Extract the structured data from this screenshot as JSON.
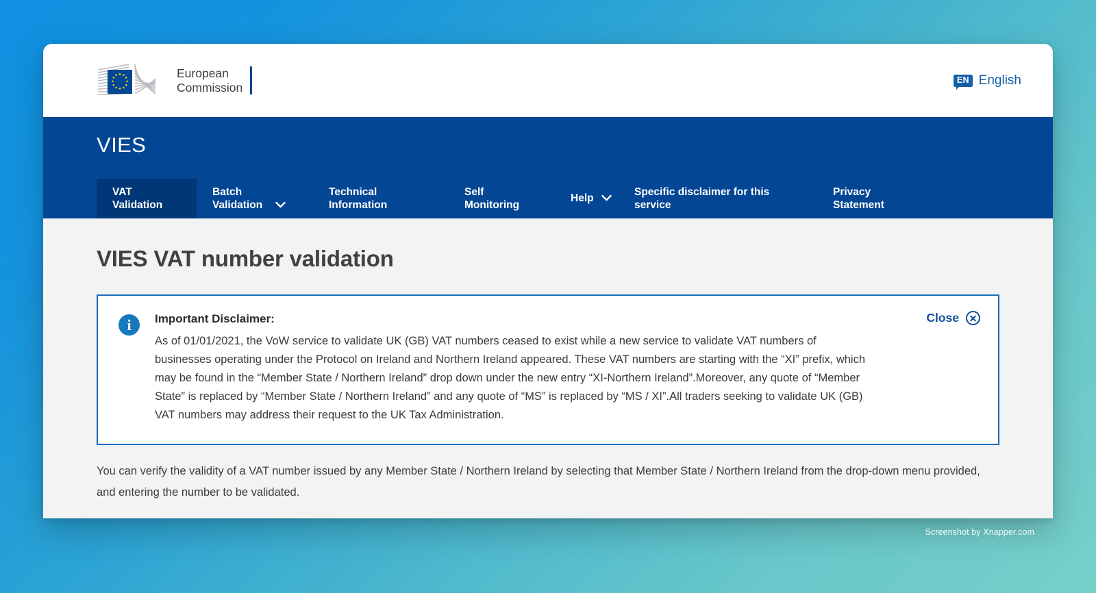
{
  "header": {
    "logo_line1": "European",
    "logo_line2": "Commission",
    "language": {
      "code": "EN",
      "label": "English"
    }
  },
  "nav": {
    "site_title": "VIES",
    "items": [
      {
        "label": "VAT\nValidation",
        "active": true,
        "has_chevron": false
      },
      {
        "label": "Batch\nValidation",
        "active": false,
        "has_chevron": true
      },
      {
        "label": "Technical\nInformation",
        "active": false,
        "has_chevron": false
      },
      {
        "label": "Self\nMonitoring",
        "active": false,
        "has_chevron": false
      },
      {
        "label": "Help",
        "active": false,
        "has_chevron": true
      },
      {
        "label": "Specific disclaimer for this\nservice",
        "active": false,
        "has_chevron": false
      },
      {
        "label": "Privacy\nStatement",
        "active": false,
        "has_chevron": false
      }
    ]
  },
  "main": {
    "page_title": "VIES VAT number validation",
    "disclaimer": {
      "icon": "info-icon",
      "title": "Important Disclaimer:",
      "text": "As of 01/01/2021, the VoW service to validate UK (GB) VAT numbers ceased to exist while a new service to validate VAT numbers of businesses operating under the Protocol on Ireland and Northern Ireland appeared. These VAT numbers are starting with the “XI” prefix, which may be found in the “Member State / Northern Ireland” drop down under the new entry “XI-Northern Ireland”.Moreover, any quote of “Member State” is replaced by “Member State / Northern Ireland” and any quote of “MS” is replaced by “MS / XI”.All traders seeking to validate UK (GB) VAT numbers may address their request to the UK Tax Administration.",
      "close_label": "Close"
    },
    "intro_text": "You can verify the validity of a VAT number issued by any Member State / Northern Ireland by selecting that Member State / Northern Ireland from the drop-down menu provided, and entering the number to be validated."
  },
  "watermark": "Screenshot by Xnapper.com",
  "colors": {
    "nav_blue": "#034694",
    "active_tab_blue": "#003776",
    "link_blue": "#14509c",
    "info_blue": "#1678bd",
    "page_bg": "#f3f3f3",
    "backdrop_start": "#0f90e0",
    "backdrop_end": "#76cfc9"
  }
}
